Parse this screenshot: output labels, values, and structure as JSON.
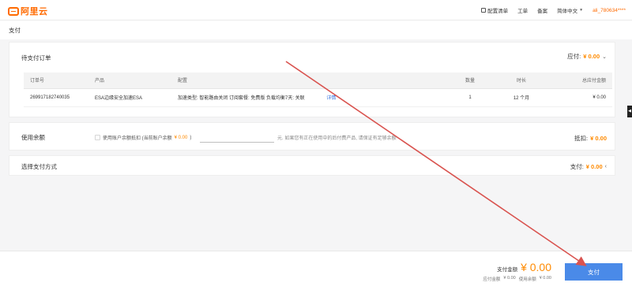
{
  "header": {
    "logo_text": "阿里云",
    "nav": {
      "config_list": "配置清单",
      "tickets": "工单",
      "filing": "备案",
      "language": "简体中文",
      "account": "ali_780634****"
    }
  },
  "page": {
    "title": "支付"
  },
  "orders": {
    "section_title": "待支付订单",
    "payable_label": "应付:",
    "payable_amount": "¥ 0.00",
    "columns": {
      "order_no": "订单号",
      "product": "产品",
      "config": "配置",
      "quantity": "数量",
      "duration": "时长",
      "total": "总应付金额"
    },
    "rows": [
      {
        "order_no": "269917182740035",
        "product": "ESA边缘安全加速ESA",
        "config": "加速类型: 智能路由关闭 订阅套餐: 免费版 负载均衡7天: 关联",
        "detail_link": "详情",
        "quantity": "1",
        "duration": "12 个月",
        "total": "¥ 0.00"
      }
    ]
  },
  "balance": {
    "section_title": "使用余额",
    "option_label": "使用账户余额抵扣 (当前账户余额",
    "option_balance": "¥ 0.00",
    "option_suffix": ")",
    "unit_hint": "元. 如果您有正在使用中的后付费产品, 请保证有足够余额",
    "deduct_label": "抵扣:",
    "deduct_amount": "¥ 0.00"
  },
  "pay_method": {
    "section_title": "选择支付方式",
    "label": "支付:",
    "amount": "¥ 0.00"
  },
  "footer": {
    "pay_amount_label": "支付金额",
    "pay_amount": "¥ 0.00",
    "payable_label": "应付金额",
    "payable_value": "¥ 0.00",
    "balance_label": "使用余额",
    "balance_value": "¥ 0.00",
    "pay_button": "支付"
  },
  "colors": {
    "accent": "#ff6a00",
    "amount": "#ff8a00",
    "pay_button": "#4a8ae8",
    "annotation_arrow": "#d9534f"
  }
}
